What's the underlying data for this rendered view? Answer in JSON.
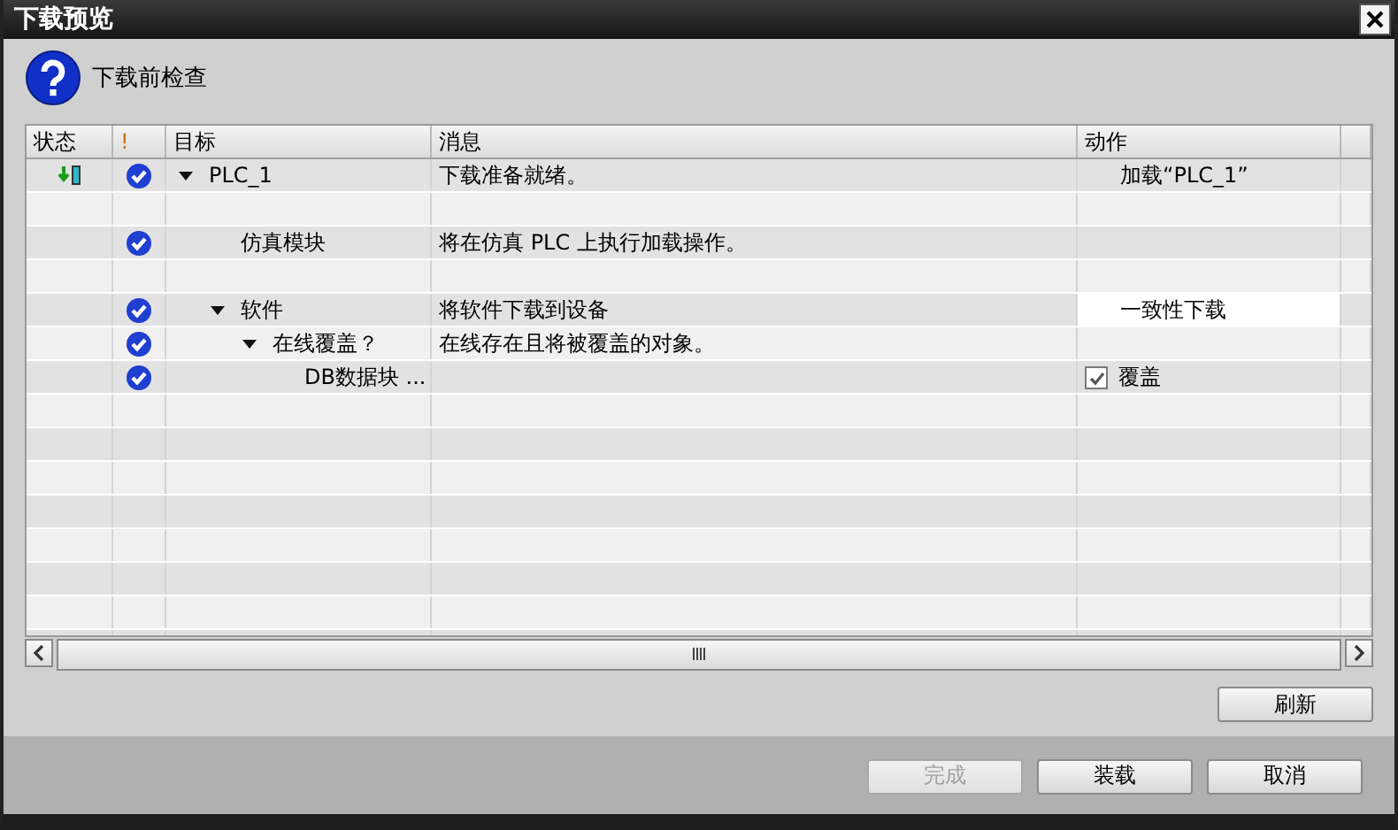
{
  "window": {
    "title": "下载预览"
  },
  "heading": "下载前检查",
  "table": {
    "columns": [
      "状态",
      "!",
      "目标",
      "消息",
      "动作"
    ],
    "rows": [
      {
        "kind": "item",
        "download_ready": true,
        "passed": true,
        "target": "PLC_1",
        "expanded": true,
        "message": "下载准备就绪。",
        "action": {
          "kind": "text",
          "text": "加载“PLC_1”"
        },
        "children": [
          {
            "kind": "blank"
          },
          {
            "kind": "item",
            "passed": true,
            "target": "仿真模块",
            "message": "将在仿真 PLC 上执行加载操作。"
          },
          {
            "kind": "blank"
          },
          {
            "kind": "item",
            "passed": true,
            "target": "软件",
            "expanded": true,
            "message": "将软件下载到设备",
            "action": {
              "kind": "select",
              "text": "一致性下载"
            },
            "children": [
              {
                "kind": "item",
                "passed": true,
                "target": "在线覆盖？",
                "expanded": true,
                "message": "在线存在且将被覆盖的对象。",
                "children": [
                  {
                    "kind": "item",
                    "passed": true,
                    "target": "DB数据块 ...",
                    "action": {
                      "kind": "checkbox",
                      "text": "覆盖",
                      "checked": true
                    }
                  }
                ]
              }
            ]
          }
        ]
      }
    ]
  },
  "refresh_button": "刷新",
  "buttons": [
    {
      "label": "完成",
      "disabled": true
    },
    {
      "label": "装载",
      "disabled": false
    },
    {
      "label": "取消",
      "disabled": false
    }
  ]
}
